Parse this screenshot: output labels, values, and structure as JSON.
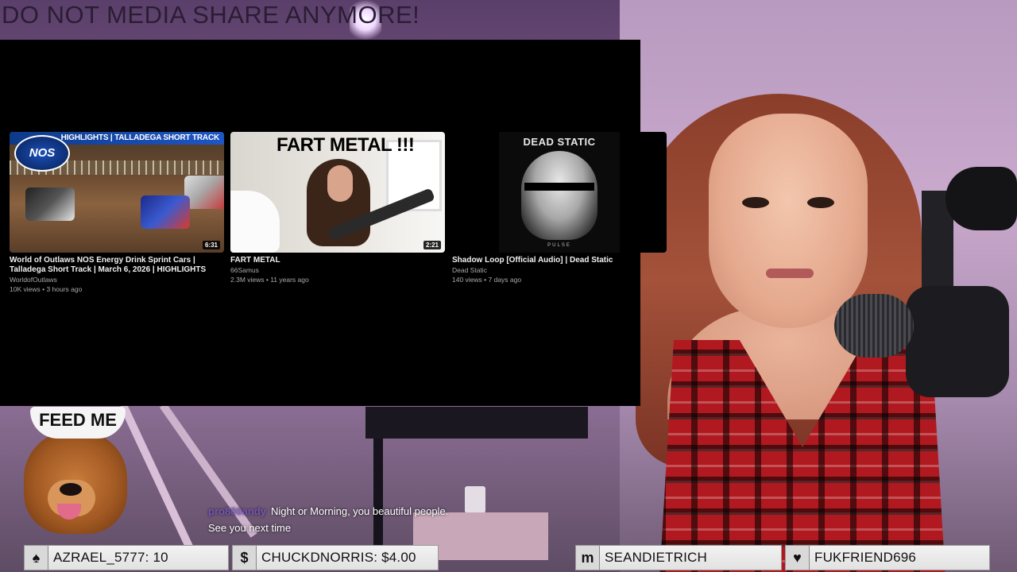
{
  "banner": {
    "text": "DO NOT MEDIA SHARE ANYMORE!"
  },
  "media_panel": {
    "videos": [
      {
        "thumb_overlay": "HIGHLIGHTS | TALLADEGA SHORT TRACK",
        "logo_text": "NOS",
        "duration": "6:31",
        "title": "World of Outlaws NOS Energy Drink Sprint Cars | Talladega Short Track | March 6, 2026 | HIGHLIGHTS",
        "channel": "WorldofOutlaws",
        "meta": "10K views • 3 hours ago"
      },
      {
        "thumb_overlay": "FART METAL !!!",
        "duration": "2:21",
        "title": "FART METAL",
        "channel": "66Samus",
        "meta": "2.3M views • 11 years ago"
      },
      {
        "thumb_overlay": "DEAD STATIC",
        "thumb_subtitle": "PULSE",
        "title": "Shadow Loop [Official Audio] | Dead Static",
        "channel": "Dead Static",
        "meta": "140 views • 7 days ago"
      }
    ]
  },
  "alert": {
    "hat_text": "FEED ME"
  },
  "chat": {
    "username": "pro800andy",
    "message": "Night or Morning, you beautiful people. See you next time"
  },
  "ticker": [
    {
      "icon": "spade-icon",
      "glyph": "♠",
      "text": "AZRAEL_5777: 10"
    },
    {
      "icon": "dollar-icon",
      "glyph": "$",
      "text": "CHUCKDNORRIS: $4.00"
    },
    {
      "icon": "m-icon",
      "glyph": "m",
      "text": "SEANDIETRICH"
    },
    {
      "icon": "heart-icon",
      "glyph": "♥",
      "text": "FUKFRIEND696"
    }
  ]
}
